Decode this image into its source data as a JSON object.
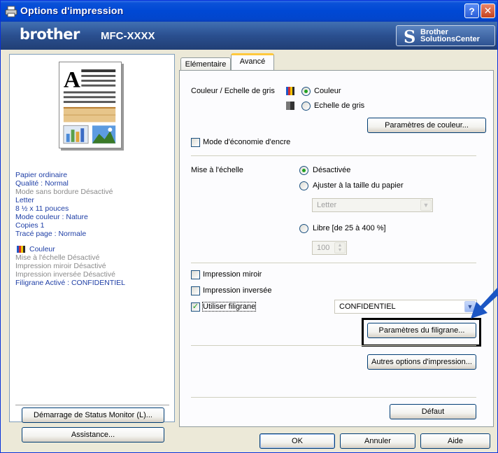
{
  "window": {
    "title": "Options d'impression",
    "help_button": "?",
    "close_button": "✕"
  },
  "brand": {
    "logo": "brother",
    "model": "MFC-XXXX",
    "solutions_line1": "Brother",
    "solutions_line2": "SolutionsCenter"
  },
  "summary": {
    "lines_blue": [
      "Papier ordinaire",
      "Qualité : Normal"
    ],
    "line_gray_1": "Mode sans bordure Désactivé",
    "lines_blue_2": [
      "Letter",
      "8 ½ x 11 pouces",
      "Mode couleur : Nature",
      "Copies 1",
      "Tracé page : Normale"
    ],
    "color_label": "Couleur",
    "lines_gray_2": [
      "Mise à l'échelle Désactivé",
      "Impression miroir Désactivé",
      "Impression inversée Désactivé"
    ],
    "watermark_line": "Filigrane Activé : CONFIDENTIEL"
  },
  "left_buttons": {
    "status_monitor": "Démarrage de Status Monitor (L)...",
    "assistance": "Assistance..."
  },
  "tabs": [
    {
      "label": "Elémentaire",
      "active": false
    },
    {
      "label": "Avancé",
      "active": true
    }
  ],
  "color_section": {
    "label": "Couleur / Echelle de gris",
    "option_color": "Couleur",
    "option_gray": "Echelle de gris",
    "selected": "Couleur",
    "settings_button": "Paramètres de couleur..."
  },
  "ink_save": {
    "label": "Mode d'économie d'encre",
    "checked": false
  },
  "scaling": {
    "label": "Mise à l'échelle",
    "option_off": "Désactivée",
    "option_fit": "Ajuster à la taille du papier",
    "fit_select_value": "Letter",
    "option_free": "Libre [de 25 à 400 %]",
    "free_value": "100",
    "selected": "Désactivée"
  },
  "mirror": {
    "label": "Impression miroir",
    "checked": false
  },
  "reverse": {
    "label": "Impression inversée",
    "checked": false
  },
  "watermark": {
    "label": "Utiliser filigrane",
    "checked": true,
    "select_value": "CONFIDENTIEL",
    "settings_button": "Paramètres du filigrane..."
  },
  "other_options_button": "Autres options d'impression...",
  "default_button": "Défaut",
  "footer": {
    "ok": "OK",
    "cancel": "Annuler",
    "help": "Aide"
  },
  "colors": {
    "title_bar": "#0048d4",
    "brand_bar": "#2a4f8f",
    "dialog_bg": "#ece9d8",
    "summary_text": "#1f3fa6",
    "callout_arrow": "#1c56c4"
  }
}
